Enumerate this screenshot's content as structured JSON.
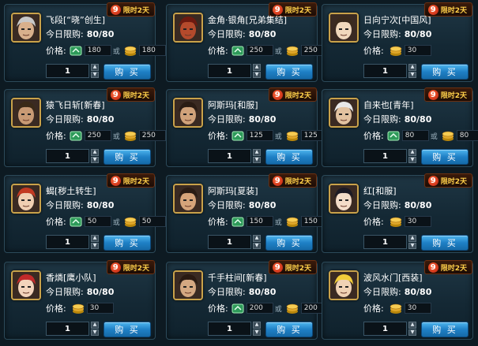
{
  "badge": {
    "number": "9",
    "text": "限时2天"
  },
  "labels": {
    "limit": "今日限购:",
    "price": "价格:",
    "or": "或",
    "buy": "购 买"
  },
  "items": [
    {
      "name": "飞段[“晓”创生]",
      "limit": "80/80",
      "gem_price": "180",
      "coin_price": "180",
      "qty": "1",
      "avatar": "hidan-avatar",
      "skin": "#d9b08c",
      "hair": "#c8c8c8"
    },
    {
      "name": "金角·银角[兄弟集结]",
      "limit": "80/80",
      "gem_price": "250",
      "coin_price": "250",
      "qty": "1",
      "avatar": "kinkaku-ginkaku-avatar",
      "skin": "#b44a2c",
      "hair": "#6d1a10"
    },
    {
      "name": "日向宁次[中国风]",
      "limit": "80/80",
      "gem_price": "",
      "coin_price": "30",
      "qty": "1",
      "avatar": "neji-avatar",
      "skin": "#f0d8bc",
      "hair": "#3a2a1c"
    },
    {
      "name": "猿飞日斩[新春]",
      "limit": "80/80",
      "gem_price": "250",
      "coin_price": "250",
      "qty": "1",
      "avatar": "hiruzen-avatar",
      "skin": "#c89a74",
      "hair": "#3a2a18"
    },
    {
      "name": "阿斯玛[和服]",
      "limit": "80/80",
      "gem_price": "125",
      "coin_price": "125",
      "qty": "1",
      "avatar": "asuma-avatar",
      "skin": "#d0a27a",
      "hair": "#2a1c14"
    },
    {
      "name": "自来也[青年]",
      "limit": "80/80",
      "gem_price": "80",
      "coin_price": "80",
      "qty": "1",
      "avatar": "jiraiya-avatar",
      "skin": "#e2c2a0",
      "hair": "#e8e8e8"
    },
    {
      "name": "蝎[秽土转生]",
      "limit": "80/80",
      "gem_price": "50",
      "coin_price": "50",
      "qty": "1",
      "avatar": "sasori-avatar",
      "skin": "#f0cfb2",
      "hair": "#c23a22"
    },
    {
      "name": "阿斯玛[夏装]",
      "limit": "80/80",
      "gem_price": "150",
      "coin_price": "150",
      "qty": "1",
      "avatar": "asuma-summer-avatar",
      "skin": "#d6a47a",
      "hair": "#2a1c14"
    },
    {
      "name": "红[和服]",
      "limit": "80/80",
      "gem_price": "",
      "coin_price": "30",
      "qty": "1",
      "avatar": "kurenai-avatar",
      "skin": "#f3dcc8",
      "hair": "#1c1a24"
    },
    {
      "name": "香燐[鹰小队]",
      "limit": "80/80",
      "gem_price": "",
      "coin_price": "30",
      "qty": "1",
      "avatar": "karin-avatar",
      "skin": "#f3d4bc",
      "hair": "#c22a2a"
    },
    {
      "name": "千手柱间[新春]",
      "limit": "80/80",
      "gem_price": "200",
      "coin_price": "200",
      "qty": "1",
      "avatar": "hashirama-avatar",
      "skin": "#d4a882",
      "hair": "#2a1a12"
    },
    {
      "name": "波风水门[西装]",
      "limit": "80/80",
      "gem_price": "",
      "coin_price": "30",
      "qty": "1",
      "avatar": "minato-avatar",
      "skin": "#f0d2b4",
      "hair": "#f2cc3a"
    }
  ]
}
